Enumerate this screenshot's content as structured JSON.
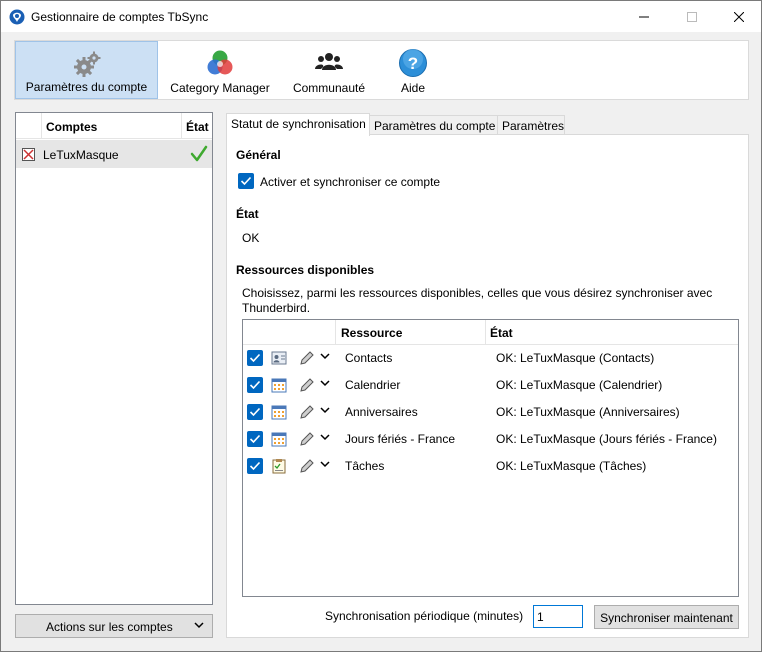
{
  "window": {
    "title": "Gestionnaire de comptes TbSync",
    "minimize_icon": "minimize-icon",
    "maximize_icon": "maximize-icon",
    "close_icon": "close-icon"
  },
  "toolbar": {
    "items": [
      {
        "label": "Paramètres du compte",
        "icon": "gears-icon",
        "active": true
      },
      {
        "label": "Category Manager",
        "icon": "color-circles-icon",
        "active": false
      },
      {
        "label": "Communauté",
        "icon": "people-icon",
        "active": false
      },
      {
        "label": "Aide",
        "icon": "help-icon",
        "active": false
      }
    ]
  },
  "accounts": {
    "header_comptes": "Comptes",
    "header_etat": "État",
    "rows": [
      {
        "name": "LeTuxMasque",
        "icon": "account-icon",
        "status_icon": "checkmark-icon"
      }
    ],
    "actions_button": "Actions sur les comptes"
  },
  "tabs": [
    "Statut de synchronisation",
    "Paramètres du compte",
    "Paramètres"
  ],
  "selected_tab": "Statut de synchronisation",
  "status": {
    "general_title": "Général",
    "enable_label": "Activer et synchroniser ce compte",
    "enable_checked": true,
    "state_title": "État",
    "state_value": "OK",
    "resources_title": "Ressources disponibles",
    "resources_desc_line1": "Choisissez, parmi les ressources disponibles, celles que vous désirez synchroniser avec",
    "resources_desc_line2": "Thunderbird.",
    "col_resource": "Ressource",
    "col_state": "État",
    "resources": [
      {
        "name": "Contacts",
        "state": "OK: LeTuxMasque (Contacts)",
        "icon": "addressbook-icon",
        "checked": true
      },
      {
        "name": "Calendrier",
        "state": "OK: LeTuxMasque (Calendrier)",
        "icon": "calendar-icon",
        "checked": true
      },
      {
        "name": "Anniversaires",
        "state": "OK: LeTuxMasque (Anniversaires)",
        "icon": "calendar-icon",
        "checked": true
      },
      {
        "name": "Jours fériés - France",
        "state": "OK: LeTuxMasque (Jours fériés - France)",
        "icon": "calendar-icon",
        "checked": true
      },
      {
        "name": "Tâches",
        "state": "OK: LeTuxMasque (Tâches)",
        "icon": "tasks-icon",
        "checked": true
      }
    ],
    "sync_label": "Synchronisation périodique (minutes)",
    "sync_value": "1",
    "sync_button": "Synchroniser maintenant"
  },
  "colors": {
    "accent": "#0067c0",
    "active_tab_bg": "#cce0f4",
    "check_green": "#3fa92f"
  }
}
